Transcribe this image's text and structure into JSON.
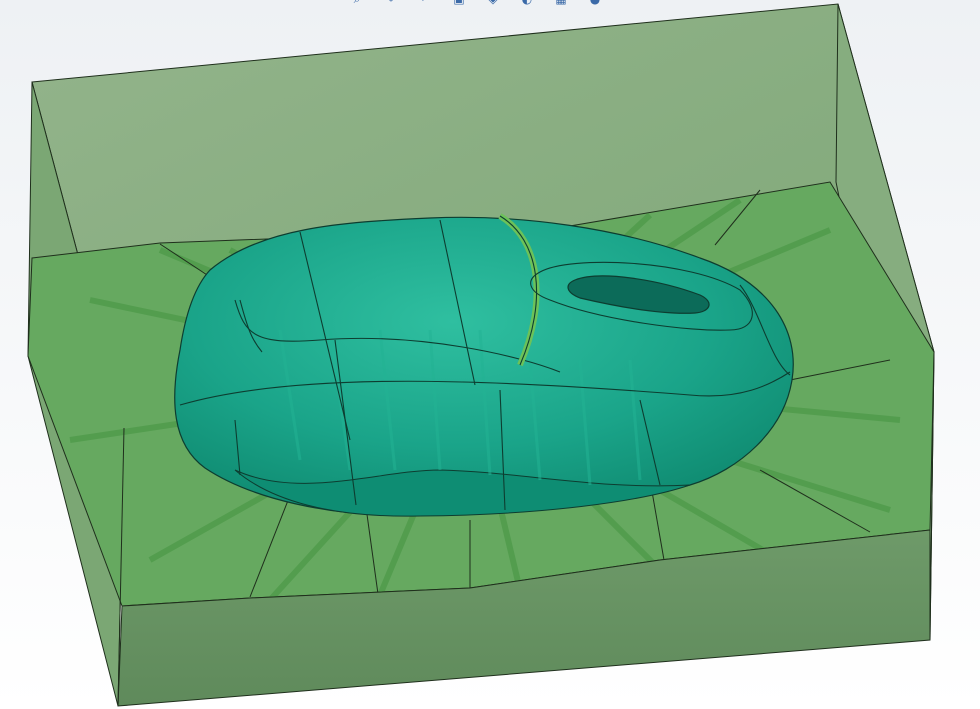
{
  "app": {
    "window_title": ""
  },
  "heads_up_toolbar": {
    "icons": [
      "zoom-to-fit-icon",
      "zoom-area-icon",
      "previous-view-icon",
      "section-view-icon",
      "view-orientation-icon",
      "display-style-icon",
      "hide-show-items-icon",
      "edit-appearance-icon"
    ]
  },
  "viewport": {
    "model": "mouse-shell-in-mold-block",
    "colors": {
      "background_top": "#eef1f4",
      "background_bottom": "#ffffff",
      "mold_block": "#6f9a6a",
      "mold_block_light": "#8fb489",
      "parting_surface": "#63a85e",
      "part_surface": "#1aa489",
      "part_surface_light": "#32c2a4",
      "part_edges": "#0d3d30",
      "scroll_wheel": "#8fc86e"
    }
  }
}
